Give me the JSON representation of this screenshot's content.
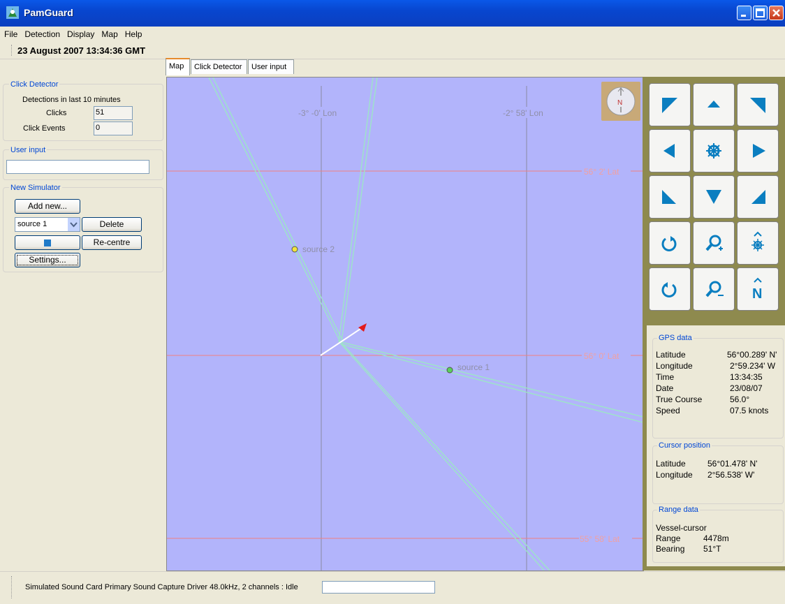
{
  "window": {
    "title": "PamGuard"
  },
  "menu": [
    "File",
    "Detection",
    "Display",
    "Map",
    "Help"
  ],
  "date_display": "23 August 2007 13:34:36 GMT",
  "click_detector": {
    "title": "Click Detector",
    "caption": "Detections in last 10 minutes",
    "clicks_label": "Clicks",
    "clicks_value": "51",
    "events_label": "Click Events",
    "events_value": "0"
  },
  "user_input": {
    "title": "User input",
    "value": ""
  },
  "simulator": {
    "title": "New Simulator",
    "add_label": "Add new...",
    "source_selected": "source 1",
    "delete_label": "Delete",
    "recentre_label": "Re-centre",
    "settings_label": "Settings..."
  },
  "tabs": [
    "Map",
    "Click Detector",
    "User input"
  ],
  "map": {
    "lon_labels": [
      "-3° -0' Lon",
      "-2° 58' Lon"
    ],
    "lat_labels": [
      "56° 2' Lat",
      "56° 0' Lat",
      "55° 58' Lat"
    ],
    "sources": [
      {
        "label": "source 2",
        "color": "#F2E43C"
      },
      {
        "label": "source 1",
        "color": "#5BD15B"
      }
    ],
    "compass_letter": "N",
    "background": "#B2B4FB",
    "bearing_line_color": "#9CE8C4",
    "grid_line_color": "#F08080"
  },
  "gps": {
    "title": "GPS data",
    "rows": [
      {
        "label": "Latitude",
        "value": "56°00.289' N'"
      },
      {
        "label": "Longitude",
        "value": "2°59.234' W"
      },
      {
        "label": "Time",
        "value": "13:34:35"
      },
      {
        "label": "Date",
        "value": "23/08/07"
      },
      {
        "label": "True Course",
        "value": "56.0°"
      },
      {
        "label": "Speed",
        "value": "07.5 knots"
      }
    ]
  },
  "cursor": {
    "title": "Cursor position",
    "rows": [
      {
        "label": "Latitude",
        "value": "56°01.478' N'"
      },
      {
        "label": "Longitude",
        "value": "2°56.538' W'"
      }
    ]
  },
  "range": {
    "title": "Range data",
    "heading": "Vessel-cursor",
    "rows": [
      {
        "label": "Range",
        "value": "4478m"
      },
      {
        "label": "Bearing",
        "value": "51°T"
      }
    ]
  },
  "status": {
    "text": "Simulated Sound Card Primary Sound Capture Driver 48.0kHz, 2 channels : Idle",
    "field_value": ""
  },
  "colors": {
    "accent": "#0046D5",
    "nav_icon": "#0A7EC0",
    "panel_frame": "#8E8A4E"
  }
}
